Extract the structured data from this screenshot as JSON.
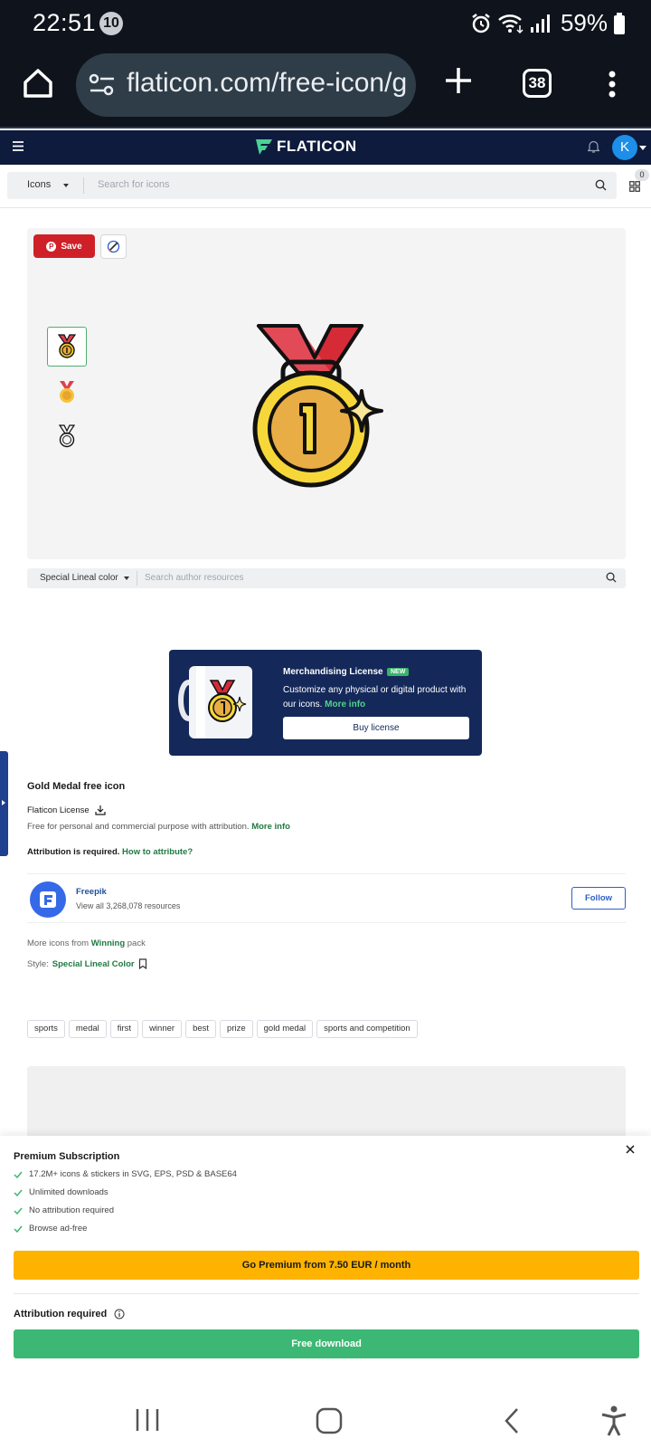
{
  "status_bar": {
    "time": "22:51",
    "notification_count": "10",
    "battery": "59%"
  },
  "browser": {
    "url": "flaticon.com/free-icon/g",
    "tab_count": "38"
  },
  "header": {
    "logo_text": "FLATICON",
    "avatar_initial": "K"
  },
  "search": {
    "type": "Icons",
    "placeholder": "Search for icons",
    "collection_count": "0"
  },
  "detail": {
    "save_label": "Save",
    "author_style": "Special Lineal color",
    "author_search_placeholder": "Search author resources"
  },
  "merch": {
    "title": "Merchandising License",
    "badge": "NEW",
    "description": "Customize any physical or digital product with our icons.",
    "more_info": "More info",
    "button": "Buy license"
  },
  "info": {
    "title": "Gold Medal free icon",
    "license_label": "Flaticon License",
    "license_desc": "Free for personal and commercial purpose with attribution.",
    "license_more": "More info",
    "attribution_required": "Attribution is required.",
    "how_to_attribute": "How to attribute?",
    "author_name": "Freepik",
    "author_resources": "View all 3,268,078 resources",
    "follow": "Follow",
    "pack_prefix": "More icons from",
    "pack_name": "Winning",
    "pack_suffix": "pack",
    "style_label": "Style:",
    "style_name": "Special Lineal Color"
  },
  "tags": [
    "sports",
    "medal",
    "first",
    "winner",
    "best",
    "prize",
    "gold medal",
    "sports and competition"
  ],
  "premium": {
    "title": "Premium Subscription",
    "features": [
      "17.2M+ icons & stickers in SVG, EPS, PSD & BASE64",
      "Unlimited downloads",
      "No attribution required",
      "Browse ad-free"
    ],
    "cta": "Go Premium from 7.50 EUR / month",
    "attribution_label": "Attribution required",
    "free_download": "Free download"
  },
  "colors": {
    "brand_navy": "#0e1b3d",
    "premium_yellow": "#fdb300",
    "download_green": "#3cb874",
    "pinterest_red": "#cf2028"
  }
}
